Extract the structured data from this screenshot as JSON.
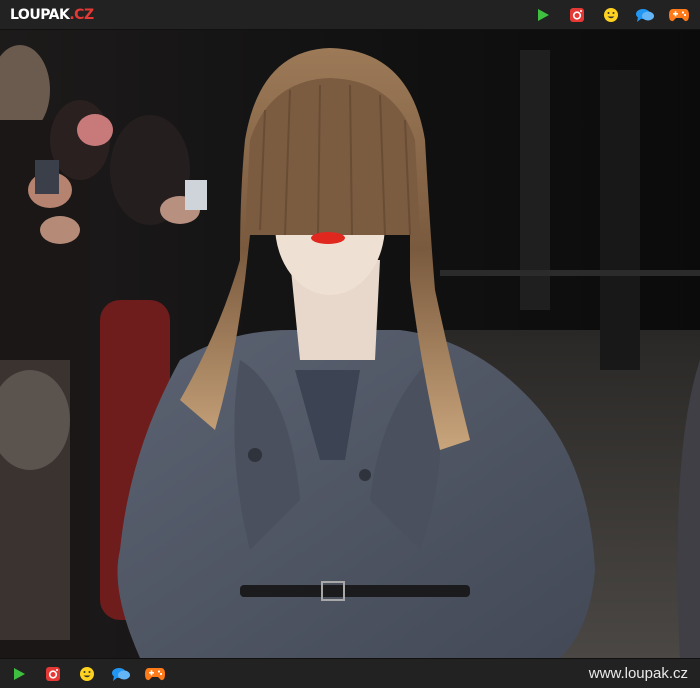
{
  "header": {
    "logo_main": "LOUPAK",
    "logo_tld": ".CZ",
    "icons": [
      "play-icon",
      "instagram-icon",
      "smiley-icon",
      "chat-icon",
      "gamepad-icon"
    ]
  },
  "footer": {
    "url": "www.loupak.cz",
    "icons": [
      "play-icon",
      "instagram-icon",
      "smiley-icon",
      "chat-icon",
      "gamepad-icon"
    ]
  },
  "colors": {
    "bar_bg": "#222222",
    "play": "#3fbf3f",
    "instagram": "#e53935",
    "smiley": "#ffd21f",
    "chat": "#2196f3",
    "gamepad": "#ff7a18",
    "coat": "#505765",
    "hair": "#8a6a4a",
    "lips": "#e0281f"
  }
}
